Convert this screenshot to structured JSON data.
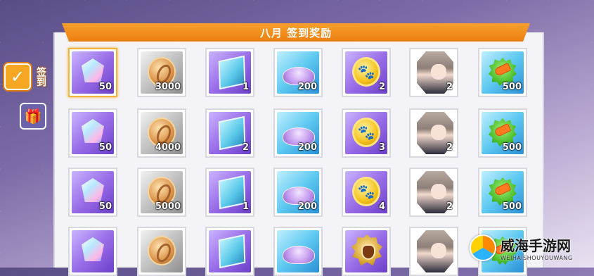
{
  "header": {
    "title": "八月 签到奖励"
  },
  "sidebar": {
    "signin_label": "签到",
    "gift_icon": "gift-box-icon",
    "calendar_icon": "calendar-check-icon"
  },
  "rewards": [
    [
      {
        "item": "crystal-gem",
        "qty": "50"
      },
      {
        "item": "gold-coin",
        "qty": "3000"
      },
      {
        "item": "blue-ticket",
        "qty": "1"
      },
      {
        "item": "purple-powder",
        "qty": "200"
      },
      {
        "item": "paw-coin",
        "qty": "2"
      },
      {
        "item": "character-portrait",
        "qty": "2"
      },
      {
        "item": "carrot-badge",
        "qty": "500"
      }
    ],
    [
      {
        "item": "crystal-gem",
        "qty": "50"
      },
      {
        "item": "gold-coin",
        "qty": "4000"
      },
      {
        "item": "blue-ticket",
        "qty": "2"
      },
      {
        "item": "purple-powder",
        "qty": "200"
      },
      {
        "item": "paw-coin",
        "qty": "3"
      },
      {
        "item": "character-portrait",
        "qty": "2"
      },
      {
        "item": "carrot-badge",
        "qty": "500"
      }
    ],
    [
      {
        "item": "crystal-gem",
        "qty": "50"
      },
      {
        "item": "gold-coin",
        "qty": "5000"
      },
      {
        "item": "blue-ticket",
        "qty": "1"
      },
      {
        "item": "purple-powder",
        "qty": "200"
      },
      {
        "item": "paw-coin",
        "qty": "4"
      },
      {
        "item": "character-portrait",
        "qty": "2"
      },
      {
        "item": "carrot-badge",
        "qty": "500"
      }
    ],
    [
      {
        "item": "crystal-gem",
        "qty": ""
      },
      {
        "item": "gold-coin",
        "qty": ""
      },
      {
        "item": "blue-ticket",
        "qty": ""
      },
      {
        "item": "purple-powder",
        "qty": ""
      },
      {
        "item": "shield-badge",
        "qty": ""
      },
      {
        "item": "character-portrait",
        "qty": ""
      },
      {
        "item": "carrot-badge",
        "qty": ""
      }
    ]
  ],
  "watermark": {
    "cn": "威海手游网",
    "en": "WEIHAISHOUYOUWANG"
  }
}
